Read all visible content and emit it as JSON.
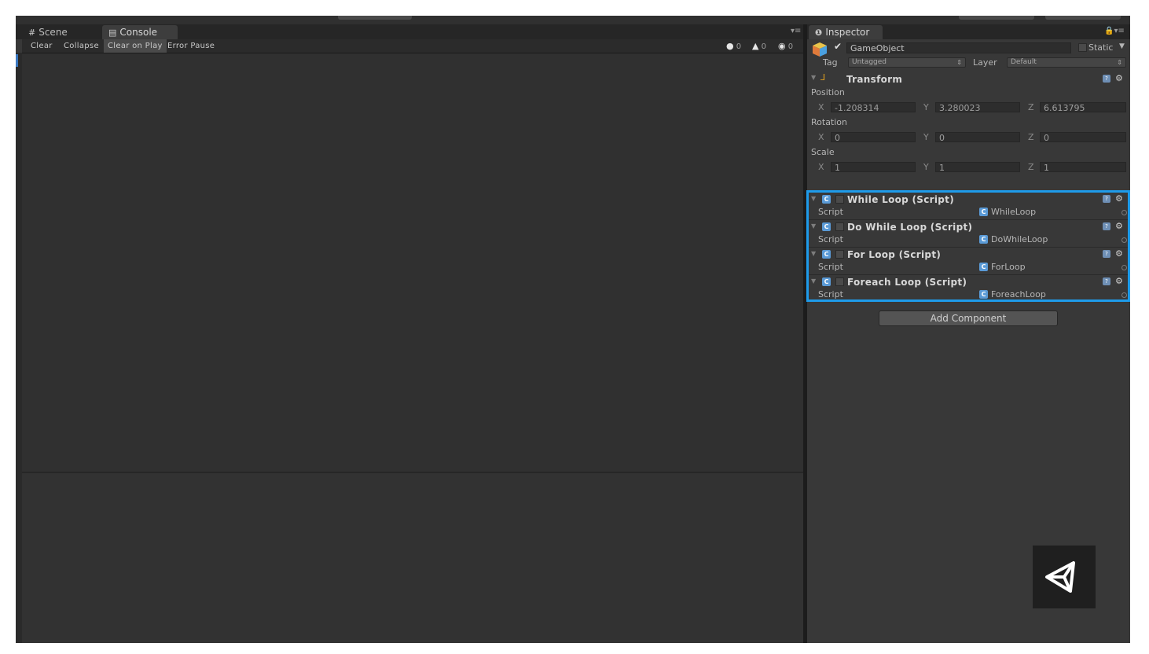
{
  "tabs": {
    "scene": "Scene",
    "console": "Console",
    "inspector": "Inspector",
    "scene_icon": "grid-icon",
    "console_icon": "console-icon",
    "inspector_icon": "info-icon"
  },
  "console_toolbar": {
    "clear": "Clear",
    "collapse": "Collapse",
    "clear_on_play": "Clear on Play",
    "error_pause": "Error Pause",
    "counts": {
      "errors": "0",
      "warnings": "0",
      "messages": "0"
    }
  },
  "inspector": {
    "object_name": "GameObject",
    "active_checked": true,
    "static_label": "Static",
    "tag_label": "Tag",
    "tag_value": "Untagged",
    "layer_label": "Layer",
    "layer_value": "Default",
    "transform": {
      "title": "Transform",
      "position_label": "Position",
      "rotation_label": "Rotation",
      "scale_label": "Scale",
      "x_label": "X",
      "y_label": "Y",
      "z_label": "Z",
      "position": {
        "x": "-1.208314",
        "y": "3.280023",
        "z": "6.613795"
      },
      "rotation": {
        "x": "0",
        "y": "0",
        "z": "0"
      },
      "scale": {
        "x": "1",
        "y": "1",
        "z": "1"
      }
    },
    "components": [
      {
        "title": "While Loop (Script)",
        "field_label": "Script",
        "value": "WhileLoop"
      },
      {
        "title": "Do While Loop (Script)",
        "field_label": "Script",
        "value": "DoWhileLoop"
      },
      {
        "title": "For Loop (Script)",
        "field_label": "Script",
        "value": "ForLoop"
      },
      {
        "title": "Foreach Loop (Script)",
        "field_label": "Script",
        "value": "ForeachLoop"
      }
    ],
    "add_component": "Add Component"
  },
  "colors": {
    "highlight": "#1e9bea",
    "panel_bg": "#383838",
    "console_bg": "#303030"
  }
}
